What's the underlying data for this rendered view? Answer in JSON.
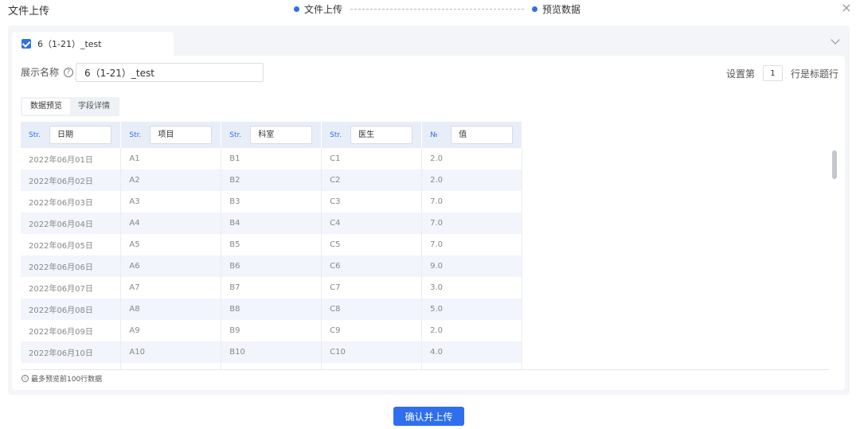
{
  "header": {
    "title": "文件上传",
    "steps": [
      "文件上传",
      "预览数据"
    ],
    "close_icon": "close-icon"
  },
  "file_tab": {
    "checked": true,
    "name": "6（1-21）_test"
  },
  "display_name": {
    "label": "展示名称",
    "value": "6（1-21）_test"
  },
  "header_row_setting": {
    "prefix": "设置第",
    "value": "1",
    "suffix": "行是标题行"
  },
  "subtabs": [
    "数据预览",
    "字段详情"
  ],
  "table": {
    "columns": [
      {
        "type": "Str.",
        "name": "日期"
      },
      {
        "type": "Str.",
        "name": "项目"
      },
      {
        "type": "Str.",
        "name": "科室"
      },
      {
        "type": "Str.",
        "name": "医生"
      },
      {
        "type": "№",
        "name": "值"
      }
    ],
    "rows": [
      [
        "2022年06月01日",
        "A1",
        "B1",
        "C1",
        "2.0"
      ],
      [
        "2022年06月02日",
        "A2",
        "B2",
        "C2",
        "2.0"
      ],
      [
        "2022年06月03日",
        "A3",
        "B3",
        "C3",
        "7.0"
      ],
      [
        "2022年06月04日",
        "A4",
        "B4",
        "C4",
        "7.0"
      ],
      [
        "2022年06月05日",
        "A5",
        "B5",
        "C5",
        "7.0"
      ],
      [
        "2022年06月06日",
        "A6",
        "B6",
        "C6",
        "9.0"
      ],
      [
        "2022年06月07日",
        "A7",
        "B7",
        "C7",
        "3.0"
      ],
      [
        "2022年06月08日",
        "A8",
        "B8",
        "C8",
        "5.0"
      ],
      [
        "2022年06月09日",
        "A9",
        "B9",
        "C9",
        "2.0"
      ],
      [
        "2022年06月10日",
        "A10",
        "B10",
        "C10",
        "4.0"
      ]
    ]
  },
  "note": "最多预览前100行数据",
  "confirm_button": "确认并上传",
  "colors": {
    "accent": "#2f6fed",
    "header_bg": "#e8eef8",
    "stripe": "#f2f5fb",
    "panel_bg": "#f3f5f8"
  }
}
